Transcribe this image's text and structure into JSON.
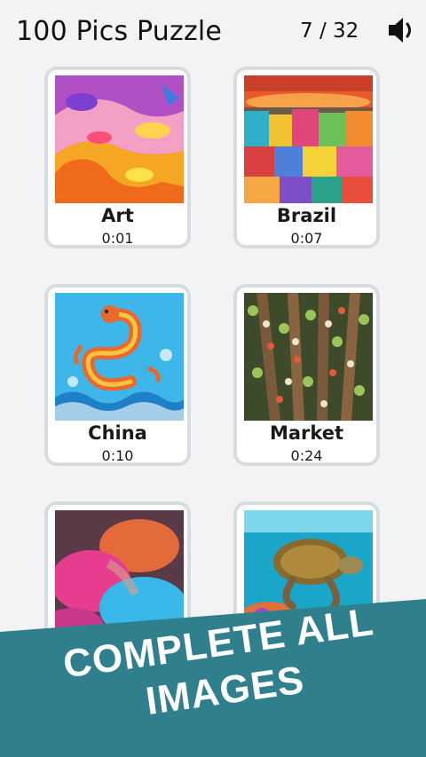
{
  "header": {
    "title": "100 Pics Puzzle",
    "progress": "7 / 32",
    "sound_icon": "speaker-icon"
  },
  "puzzles": [
    {
      "name": "Art",
      "time": "0:01"
    },
    {
      "name": "Brazil",
      "time": "0:07"
    },
    {
      "name": "China",
      "time": "0:10"
    },
    {
      "name": "Market",
      "time": "0:24"
    },
    {
      "name": "",
      "time": ""
    },
    {
      "name": "",
      "time": ""
    }
  ],
  "banner": {
    "line1": "COMPLETE ALL",
    "line2": "IMAGES",
    "color": "#2f7f8d"
  },
  "colors": {
    "background": "#f2f3f5",
    "card_border": "#d9dcdf",
    "text": "#111111"
  }
}
